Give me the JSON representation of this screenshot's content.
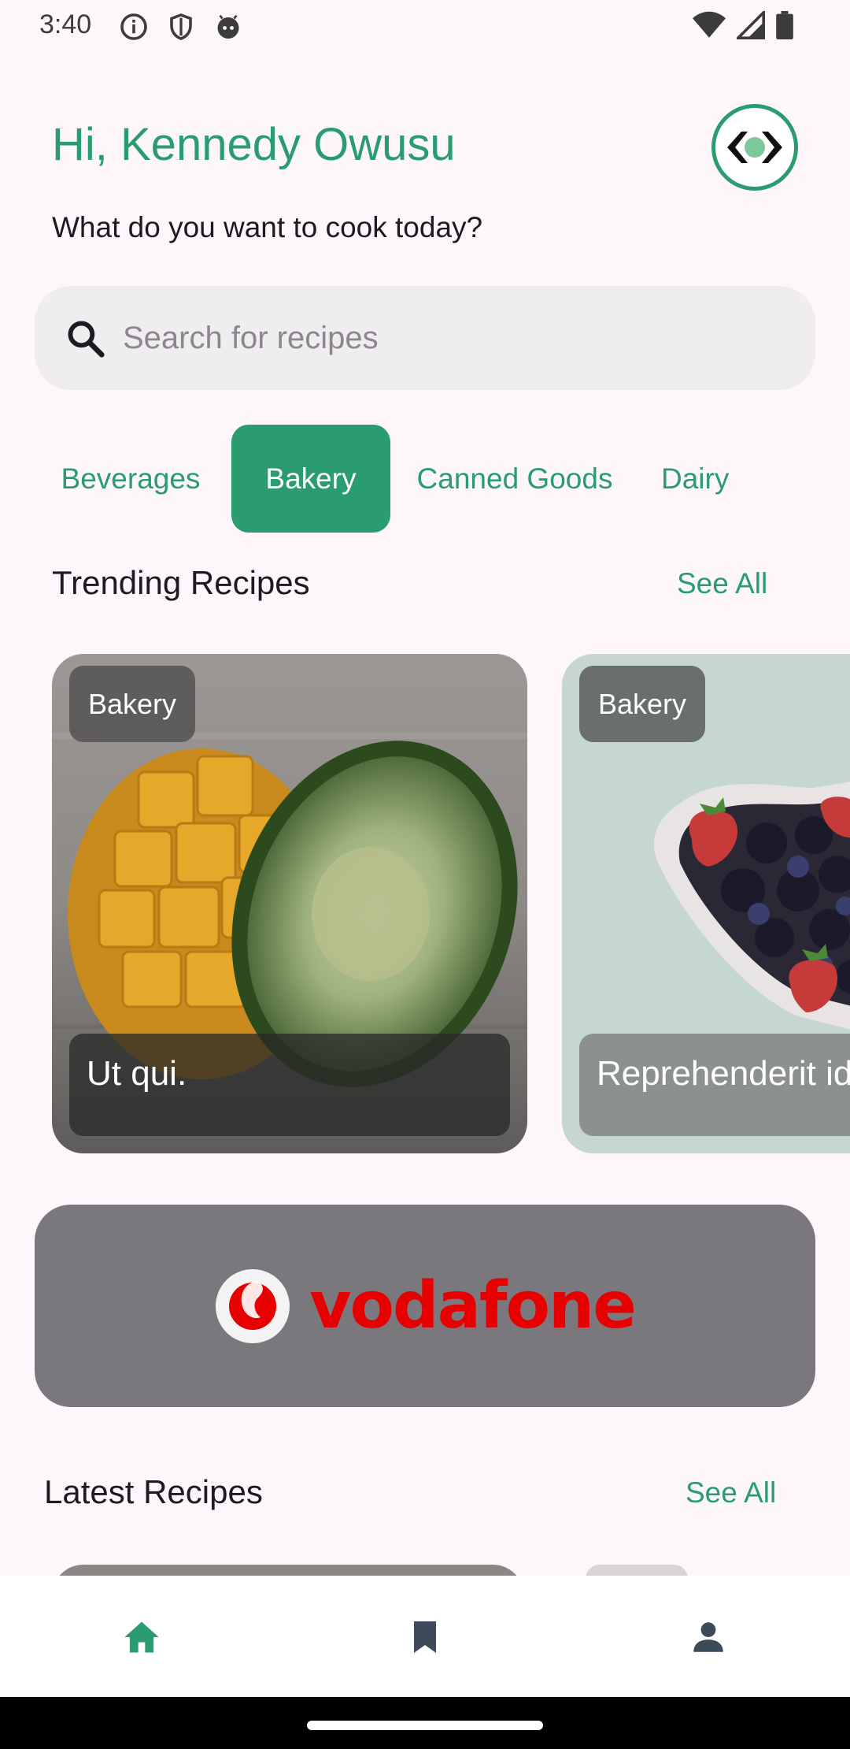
{
  "status_bar": {
    "time": "3:40",
    "left_icons": [
      "info-icon",
      "shield-icon",
      "android-face-icon"
    ],
    "right_icons": [
      "wifi-icon",
      "signal-icon",
      "battery-icon"
    ]
  },
  "header": {
    "greeting": "Hi, Kennedy Owusu",
    "subtitle": "What do you want to cook today?",
    "avatar_icon": "app-logo-icon",
    "accent_color": "#2b9b70"
  },
  "search": {
    "placeholder": "Search for recipes",
    "value": ""
  },
  "categories": [
    {
      "label": "Beverages",
      "active": false
    },
    {
      "label": "Bakery",
      "active": true
    },
    {
      "label": "Canned Goods",
      "active": false
    },
    {
      "label": "Dairy",
      "active": false
    }
  ],
  "trending": {
    "title": "Trending Recipes",
    "see_all": "See All",
    "cards": [
      {
        "tag": "Bakery",
        "title": "Ut qui.",
        "image": "mango-and-avocado-photo"
      },
      {
        "tag": "Bakery",
        "title": "Reprehenderit id",
        "image": "berries-in-heart-bowl-photo"
      }
    ]
  },
  "ad": {
    "brand": "vodafone",
    "brand_color": "#e60000"
  },
  "latest": {
    "title": "Latest Recipes",
    "see_all": "See All"
  },
  "bottom_nav": {
    "items": [
      {
        "icon": "home-icon",
        "active": true
      },
      {
        "icon": "bookmark-icon",
        "active": false
      },
      {
        "icon": "person-icon",
        "active": false
      }
    ]
  }
}
